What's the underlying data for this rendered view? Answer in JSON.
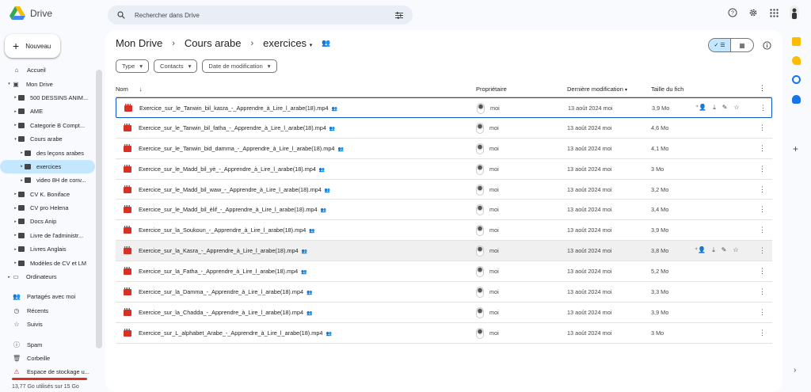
{
  "app": {
    "name": "Drive"
  },
  "search": {
    "placeholder": "Rechercher dans Drive"
  },
  "sidebar": {
    "new_label": "Nouveau",
    "items": [
      {
        "label": "Accueil",
        "icon": "home-icon",
        "level": 0
      },
      {
        "label": "Mon Drive",
        "icon": "drive-icon",
        "level": 0,
        "caret": "▾"
      },
      {
        "label": "500 DESSINS ANIM...",
        "icon": "folder-icon",
        "level": 1,
        "caret": "▸"
      },
      {
        "label": "AME",
        "icon": "folder-icon",
        "level": 1,
        "caret": "▸"
      },
      {
        "label": "Categorie B Compt...",
        "icon": "folder-icon",
        "level": 1,
        "caret": "▸"
      },
      {
        "label": "Cours arabe",
        "icon": "folder-icon",
        "level": 1,
        "caret": "▾"
      },
      {
        "label": "des leçons arabes",
        "icon": "folder-icon",
        "level": 2,
        "caret": "▸"
      },
      {
        "label": "exercices",
        "icon": "folder-icon",
        "level": 2,
        "caret": "▸",
        "active": true
      },
      {
        "label": "video 8H de conv...",
        "icon": "folder-icon",
        "level": 2,
        "caret": "▸"
      },
      {
        "label": "CV K. Boniface",
        "icon": "folder-icon",
        "level": 1,
        "caret": "▸"
      },
      {
        "label": "CV pro Helena",
        "icon": "folder-icon",
        "level": 1,
        "caret": "▸"
      },
      {
        "label": "Docs Anip",
        "icon": "folder-icon",
        "level": 1,
        "caret": "▸"
      },
      {
        "label": "Livre de l'administr...",
        "icon": "folder-icon",
        "level": 1,
        "caret": "▸"
      },
      {
        "label": "Livres Anglais",
        "icon": "folder-icon",
        "level": 1,
        "caret": "▸"
      },
      {
        "label": "Modèles de CV et LM",
        "icon": "folder-icon",
        "level": 1,
        "caret": "▸"
      },
      {
        "label": "Ordinateurs",
        "icon": "computer-icon",
        "level": 0,
        "caret": "▸"
      }
    ],
    "items2": [
      {
        "label": "Partagés avec moi",
        "icon": "shared-icon",
        "glyph": "👥"
      },
      {
        "label": "Récents",
        "icon": "clock-icon",
        "glyph": "◷"
      },
      {
        "label": "Suivis",
        "icon": "star-icon",
        "glyph": "☆"
      }
    ],
    "items3": [
      {
        "label": "Spam",
        "icon": "spam-icon",
        "glyph": "ⓘ"
      },
      {
        "label": "Corbeille",
        "icon": "trash-icon",
        "glyph": "🗑"
      },
      {
        "label": "Espace de stockage u...",
        "icon": "warning-icon",
        "glyph": "⚠"
      }
    ],
    "storage_text": "13,77 Go utilisés sur 15 Go"
  },
  "breadcrumb": {
    "root": "Mon Drive",
    "parent": "Cours arabe",
    "current": "exercices"
  },
  "filters": [
    "Type",
    "Contacts",
    "Date de modification"
  ],
  "columns": {
    "name": "Nom",
    "owner": "Propriétaire",
    "modified": "Dernière modification",
    "size": "Taille du fich"
  },
  "files": [
    {
      "name": "Exercice_sur_le_Tanwin_bil_kasra_-_Apprendre_à_Lire_l_arabe(18).mp4",
      "owner": "moi",
      "modified": "13 août 2024 moi",
      "size": "3,9 Mo"
    },
    {
      "name": "Exercice_sur_le_Tanwin_bil_fatha_-_Apprendre_à_Lire_l_arabe(18).mp4",
      "owner": "moi",
      "modified": "13 août 2024 moi",
      "size": "4,6 Mo"
    },
    {
      "name": "Exercice_sur_le_Tanwin_bid_damma_-_Apprendre_à_Lire_l_arabe(18).mp4",
      "owner": "moi",
      "modified": "13 août 2024 moi",
      "size": "4,1 Mo"
    },
    {
      "name": "Exercice_sur_le_Madd_bil_yè_-_Apprendre_à_Lire_l_arabe(18).mp4",
      "owner": "moi",
      "modified": "13 août 2024 moi",
      "size": "3 Mo"
    },
    {
      "name": "Exercice_sur_le_Madd_bil_waw_-_Apprendre_à_Lire_l_arabe(18).mp4",
      "owner": "moi",
      "modified": "13 août 2024 moi",
      "size": "3,2 Mo"
    },
    {
      "name": "Exercice_sur_le_Madd_bil_èlif_-_Apprendre_à_Lire_l_arabe(18).mp4",
      "owner": "moi",
      "modified": "13 août 2024 moi",
      "size": "3,4 Mo"
    },
    {
      "name": "Exercice_sur_la_Soukoun_-_Apprendre_à_Lire_l_arabe(18).mp4",
      "owner": "moi",
      "modified": "13 août 2024 moi",
      "size": "3,9 Mo"
    },
    {
      "name": "Exercice_sur_la_Kasra_-_Apprendre_à_Lire_l_arabe(18).mp4",
      "owner": "moi",
      "modified": "13 août 2024 moi",
      "size": "3,8 Mo"
    },
    {
      "name": "Exercice_sur_la_Fatha_-_Apprendre_à_Lire_l_arabe(18).mp4",
      "owner": "moi",
      "modified": "13 août 2024 moi",
      "size": "5,2 Mo"
    },
    {
      "name": "Exercice_sur_la_Damma_-_Apprendre_à_Lire_l_arabe(18).mp4",
      "owner": "moi",
      "modified": "13 août 2024 moi",
      "size": "3,3 Mo"
    },
    {
      "name": "Exercice_sur_la_Chadda_-_Apprendre_à_Lire_l_arabe(18).mp4",
      "owner": "moi",
      "modified": "13 août 2024 moi",
      "size": "3,9 Mo"
    },
    {
      "name": "Exercice_sur_L_alphabet_Arabe_-_Apprendre_à_Lire_l_arabe(18).mp4",
      "owner": "moi",
      "modified": "13 août 2024 moi",
      "size": "3 Mo"
    }
  ],
  "colors": {
    "accent": "#0b57d0",
    "active_bg": "#c2e7ff",
    "video_red": "#d93025"
  }
}
